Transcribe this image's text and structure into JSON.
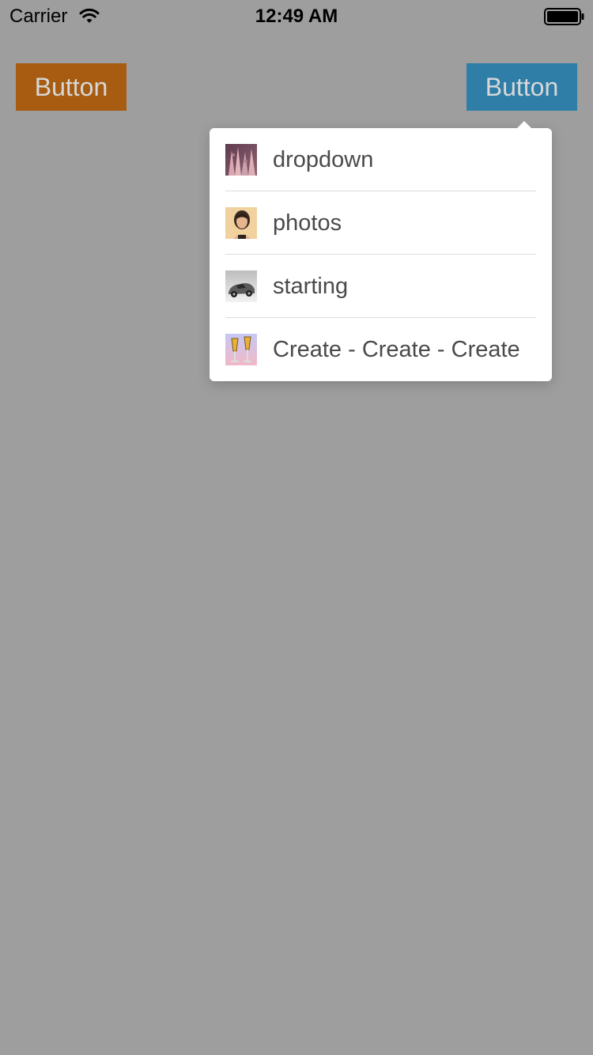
{
  "status_bar": {
    "carrier": "Carrier",
    "time": "12:49 AM",
    "wifi_icon": "wifi-icon",
    "battery_icon": "battery-icon"
  },
  "buttons": {
    "left_label": "Button",
    "right_label": "Button",
    "left_color": "#a75c12",
    "right_color": "#2e7ea8"
  },
  "dropdown": {
    "items": [
      {
        "label": "dropdown",
        "thumb_icon": "hands-photo-icon"
      },
      {
        "label": "photos",
        "thumb_icon": "portrait-photo-icon"
      },
      {
        "label": "starting",
        "thumb_icon": "car-photo-icon"
      },
      {
        "label": "Create - Create - Create",
        "thumb_icon": "champagne-photo-icon"
      }
    ]
  },
  "colors": {
    "background": "#9e9e9e",
    "dropdown_bg": "#ffffff",
    "item_text": "#4a4a4a",
    "button_text": "#d8d8d8"
  }
}
